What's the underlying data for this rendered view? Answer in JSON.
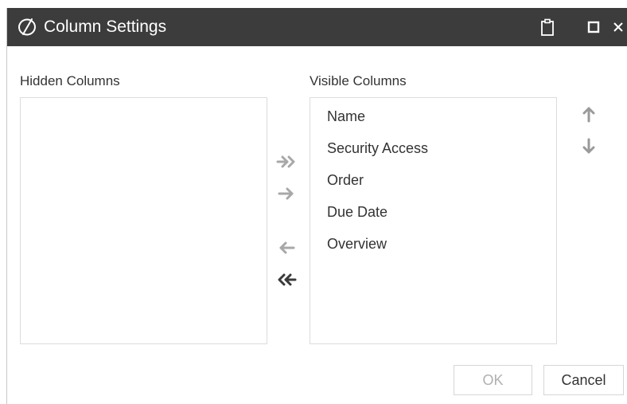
{
  "window": {
    "title": "Column Settings",
    "colors": {
      "titlebar_bg": "#3c3c3c",
      "border": "#dcdcdc",
      "arrow_light": "#a8a8a8",
      "arrow_dark": "#3a3a3a",
      "text": "#333333",
      "disabled_text": "#b0b0b0"
    },
    "icons": {
      "logo": "app-logo-icon",
      "clipboard": "clipboard-icon",
      "maximize": "maximize-icon",
      "close": "close-icon"
    }
  },
  "hidden_columns": {
    "label": "Hidden Columns",
    "items": []
  },
  "visible_columns": {
    "label": "Visible Columns",
    "items": [
      "Name",
      "Security Access",
      "Order",
      "Due Date",
      "Overview"
    ]
  },
  "transfer_controls": {
    "add_all": {
      "icon": "double-arrow-right-icon",
      "enabled": true
    },
    "add": {
      "icon": "arrow-right-icon",
      "enabled": true
    },
    "remove": {
      "icon": "arrow-left-icon",
      "enabled": true
    },
    "remove_all": {
      "icon": "double-arrow-left-icon",
      "enabled": true
    }
  },
  "order_controls": {
    "move_up": {
      "icon": "arrow-up-icon"
    },
    "move_down": {
      "icon": "arrow-down-icon"
    }
  },
  "footer": {
    "ok_label": "OK",
    "ok_enabled": false,
    "cancel_label": "Cancel"
  }
}
